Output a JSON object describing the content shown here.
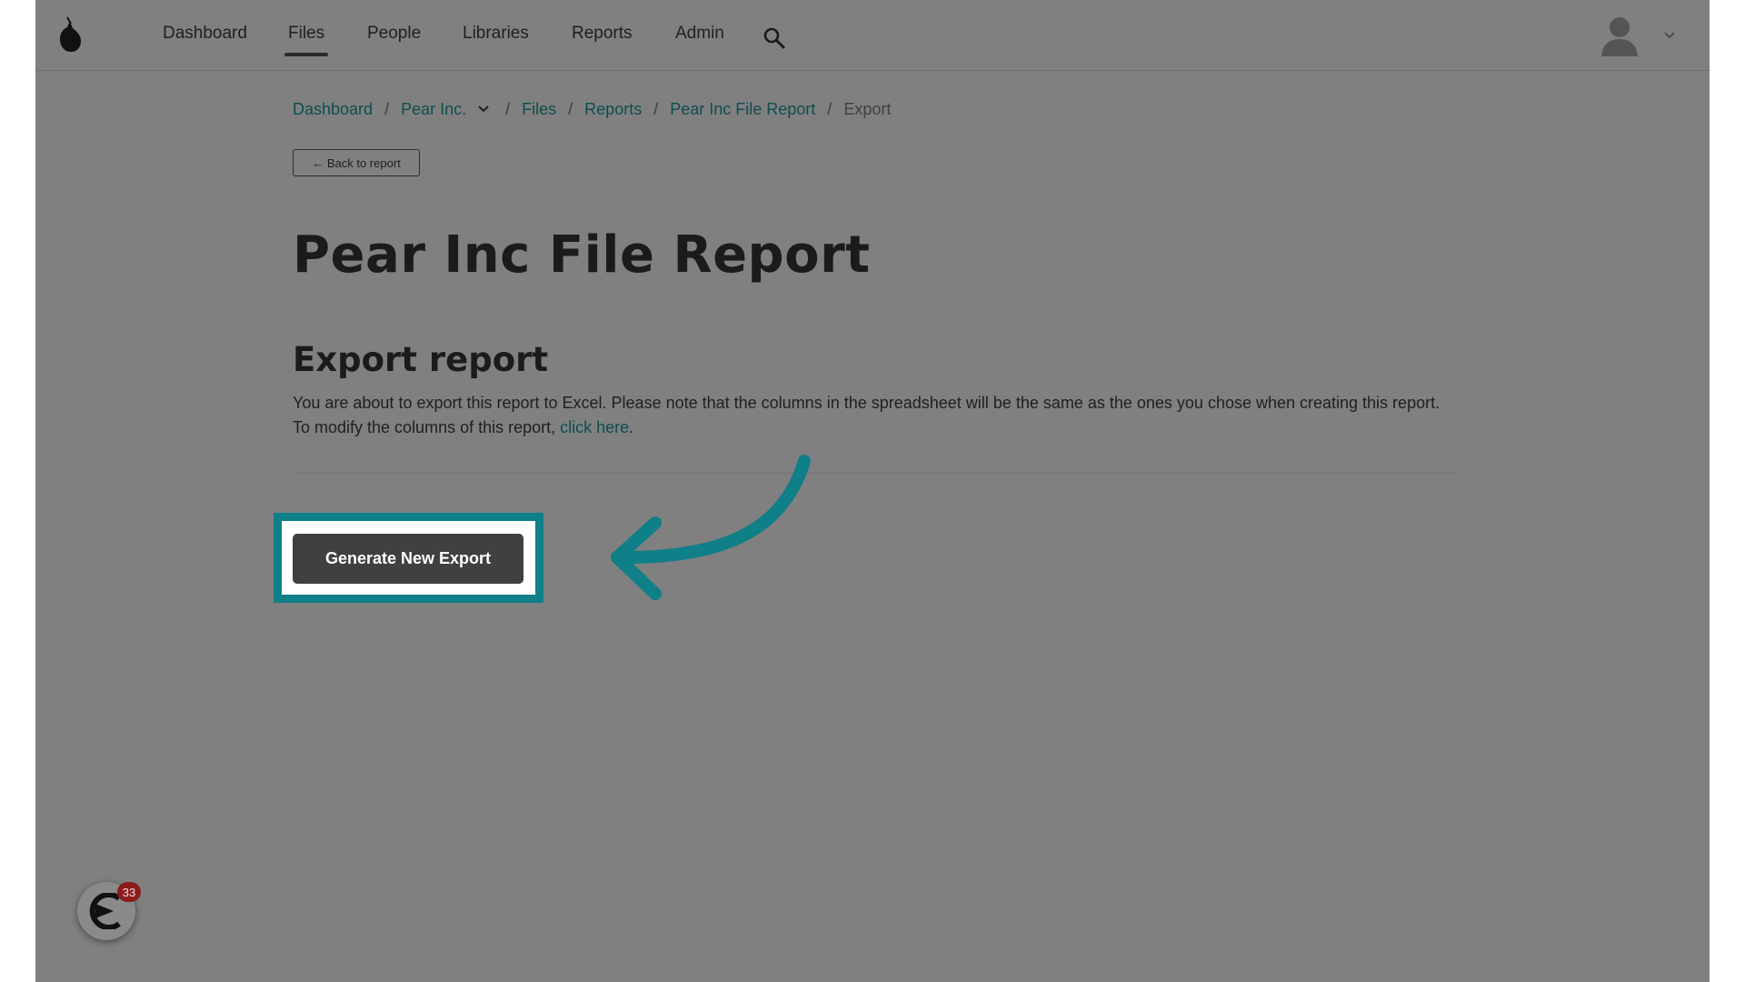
{
  "nav": {
    "items": [
      {
        "label": "Dashboard"
      },
      {
        "label": "Files"
      },
      {
        "label": "People"
      },
      {
        "label": "Libraries"
      },
      {
        "label": "Reports"
      },
      {
        "label": "Admin"
      }
    ],
    "active": "Files",
    "search_icon": "search-icon",
    "avatar_icon": "avatar-icon"
  },
  "breadcrumb": {
    "dashboard": "Dashboard",
    "org": "Pear Inc.",
    "files": "Files",
    "reports": "Reports",
    "report": "Pear Inc File Report",
    "current": "Export",
    "separator": "/"
  },
  "back_button": "← Back to report",
  "page_title": "Pear Inc File Report",
  "section_title": "Export report",
  "description": {
    "line1": "You are about to export this report to Excel. Please note that the columns in the spreadsheet will be the same as the ones you chose when creating this report.",
    "line2_prefix": "To modify the columns of this report, ",
    "link": "click here",
    "line2_suffix": "."
  },
  "generate_button": "Generate New Export",
  "widget": {
    "badge_count": "33"
  },
  "colors": {
    "overlay_bg": "#808080",
    "highlight": "#0f7f88",
    "link": "#0f4d4f",
    "button_bg": "#404040",
    "badge": "#8b1c1c"
  }
}
